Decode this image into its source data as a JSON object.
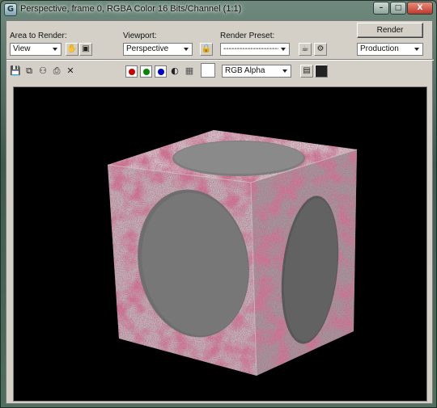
{
  "window": {
    "title": "Perspective, frame 0, RGBA Color 16 Bits/Channel (1:1)",
    "app_icon": "G",
    "controls": {
      "minimize": "–",
      "maximize": "□",
      "close": "X"
    }
  },
  "toolbar": {
    "area_to_render_label": "Area to Render:",
    "area_to_render_value": "View",
    "viewport_label": "Viewport:",
    "viewport_value": "Perspective",
    "render_preset_label": "Render Preset:",
    "render_preset_value": "--------------------------",
    "render_button": "Render",
    "render_mode_value": "Production"
  },
  "channels": {
    "red_color": "#cc0000",
    "green_color": "#008800",
    "blue_color": "#0000cc",
    "display_value": "RGB Alpha"
  },
  "icons": [
    "hand-icon",
    "region-icon",
    "lock-icon",
    "teapot-render-icon",
    "gear-icon",
    "save-icon",
    "copy-icon",
    "clone-icon",
    "print-icon",
    "clear-icon",
    "alpha-toggle-icon",
    "mono-icon",
    "swatch",
    "frame-icon",
    "display-icon"
  ],
  "viewport": {
    "background": "#000000",
    "object": "textured-cube-with-circular-insets"
  }
}
